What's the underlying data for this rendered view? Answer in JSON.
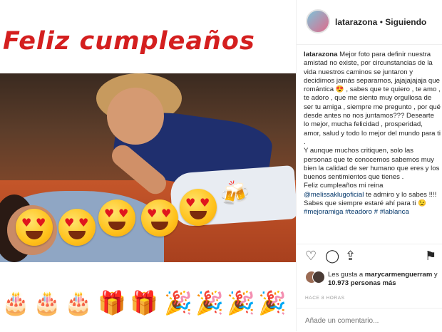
{
  "post_image": {
    "headline": "Feliz cumpleaños",
    "photo_emojis": [
      "😍",
      "😍",
      "😍",
      "😍",
      "😍",
      "🍻"
    ],
    "bottom_emojis": [
      "🎂",
      "🎂",
      "🎂",
      "🎁",
      "🎁",
      "🎉",
      "🎉",
      "🎉",
      "🎉"
    ]
  },
  "header": {
    "username": "latarazona",
    "separator": " • ",
    "follow_status": "Siguiendo"
  },
  "caption": {
    "username": "latarazona",
    "paragraphs": [
      "Mejor foto para definir nuestra amistad no existe, por circunstancias de la vida nuestros caminos se juntaron y decidimos jamás separarnos, jajajajajaja que romántica 😍 , sabes que te quiero , te amo , te adoro , que me siento muy orgullosa de ser tu amiga , siempre me pregunto , por qué desde antes no nos juntamos??? Desearte lo mejor, mucha felicidad , prosperidad, amor, salud y todo lo mejor del mundo para ti .",
      "Y aunque muchos critiquen, solo las personas que te conocemos sabemos muy bien la calidad de ser humano que eres y los buenos sentimientos que tienes .",
      "Feliz cumpleaños mi reina"
    ],
    "mention": "@melissaklugoficial",
    "mention_tail": " te admiro y lo sabes !!!!",
    "closing": "Sabes que siempre estaré ahí para ti 😉",
    "hashtags": [
      "#mejoramiga",
      "#teadoro",
      "#",
      "#lablanca"
    ]
  },
  "actions": {
    "like_icon": "♡",
    "comment_icon": "◯",
    "share_icon": "⇪",
    "save_icon": "⚑"
  },
  "likes": {
    "prefix": "Les gusta a ",
    "user": "marycarmenguerram",
    "connector": " y ",
    "others": "10.973 personas más"
  },
  "timestamp": "HACE 8 HORAS",
  "comment": {
    "placeholder": "Añade un comentario..."
  }
}
